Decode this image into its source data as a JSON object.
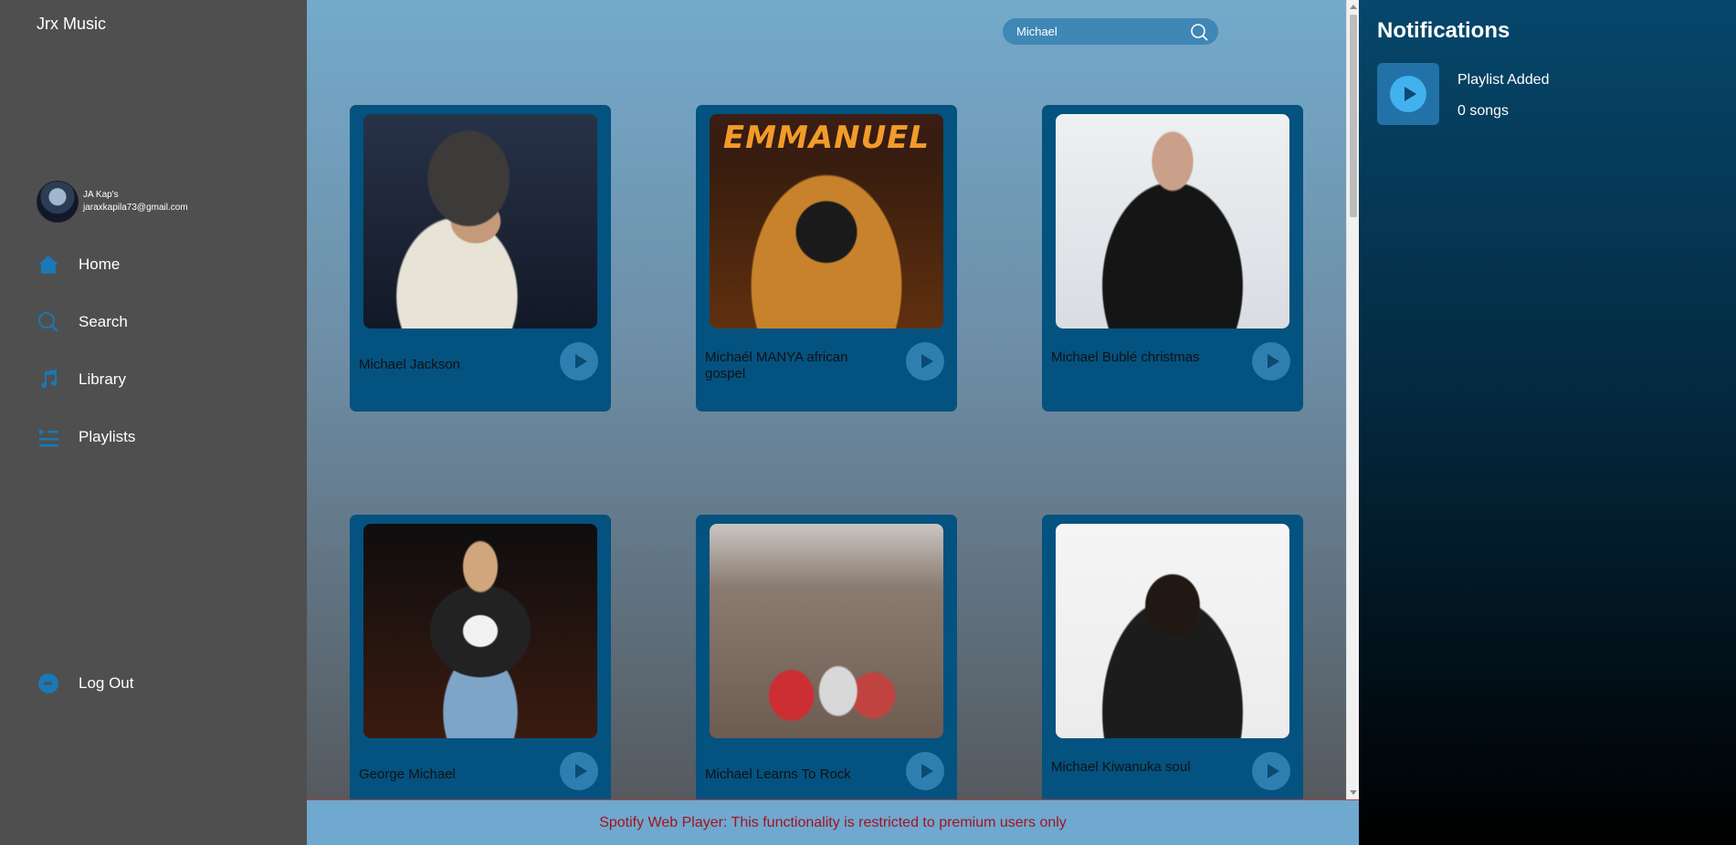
{
  "app": {
    "title": "Jrx Music"
  },
  "profile": {
    "name": "JA Kap's",
    "email": "jaraxkapila73@gmail.com"
  },
  "nav": {
    "home": "Home",
    "search": "Search",
    "library": "Library",
    "playlists": "Playlists",
    "logout": "Log Out"
  },
  "search": {
    "value": "Michael"
  },
  "results": [
    {
      "name": "Michael Jackson"
    },
    {
      "name": "Michaél MANYA african gospel",
      "art_text": "EMMANUEL"
    },
    {
      "name": "Michael Bublé christmas"
    },
    {
      "name": "George Michael"
    },
    {
      "name": "Michael Learns To Rock"
    },
    {
      "name": "Michael Kiwanuka soul"
    }
  ],
  "footer": {
    "message": "Spotify Web Player: This functionality is restricted to premium users only"
  },
  "notifications": {
    "title": "Notifications",
    "items": [
      {
        "title": "Playlist Added",
        "subtitle": "0 songs"
      }
    ]
  },
  "colors": {
    "sidebar": "#4f4f4f",
    "card": "#045280",
    "accent": "#2e7fb0",
    "footer_text": "#a4121f"
  }
}
